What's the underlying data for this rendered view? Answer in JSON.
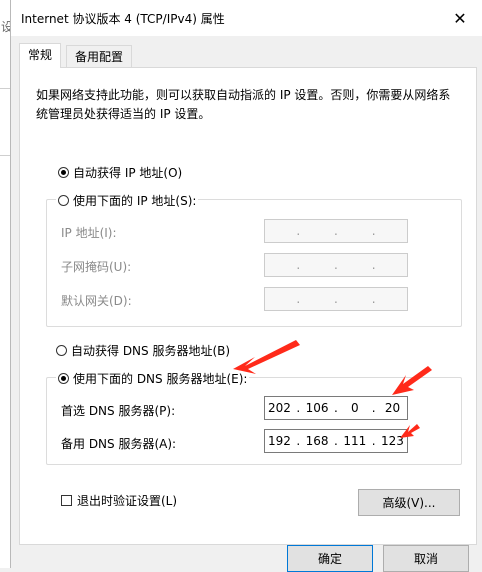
{
  "background": {
    "partial_char": "设"
  },
  "window": {
    "title": "Internet 协议版本 4 (TCP/IPv4) 属性",
    "close_glyph": "✕"
  },
  "tabs": [
    {
      "label": "常规",
      "selected": true
    },
    {
      "label": "备用配置",
      "selected": false
    }
  ],
  "description": "如果网络支持此功能，则可以获取自动指派的 IP 设置。否则，你需要从网络系统管理员处获得适当的 IP 设置。",
  "ip_section": {
    "auto_option": "自动获得 IP 地址(O)",
    "manual_option": "使用下面的 IP 地址(S):",
    "selected": "auto",
    "fields": [
      {
        "label": "IP 地址(I):",
        "value": [
          "",
          "",
          "",
          ""
        ]
      },
      {
        "label": "子网掩码(U):",
        "value": [
          "",
          "",
          "",
          ""
        ]
      },
      {
        "label": "默认网关(D):",
        "value": [
          "",
          "",
          "",
          ""
        ]
      }
    ]
  },
  "dns_section": {
    "auto_option": "自动获得 DNS 服务器地址(B)",
    "manual_option": "使用下面的 DNS 服务器地址(E):",
    "selected": "manual",
    "preferred": {
      "label": "首选 DNS 服务器(P):",
      "value": [
        "202",
        "106",
        "0",
        "20"
      ]
    },
    "alternate": {
      "label": "备用 DNS 服务器(A):",
      "value": [
        "192",
        "168",
        "111",
        "123"
      ]
    }
  },
  "validate_checkbox": {
    "label": "退出时验证设置(L)",
    "checked": false
  },
  "buttons": {
    "advanced": "高级(V)...",
    "ok": "确定",
    "cancel": "取消"
  },
  "colors": {
    "arrow": "#ff2a1a",
    "focus_border": "#0078d7"
  }
}
